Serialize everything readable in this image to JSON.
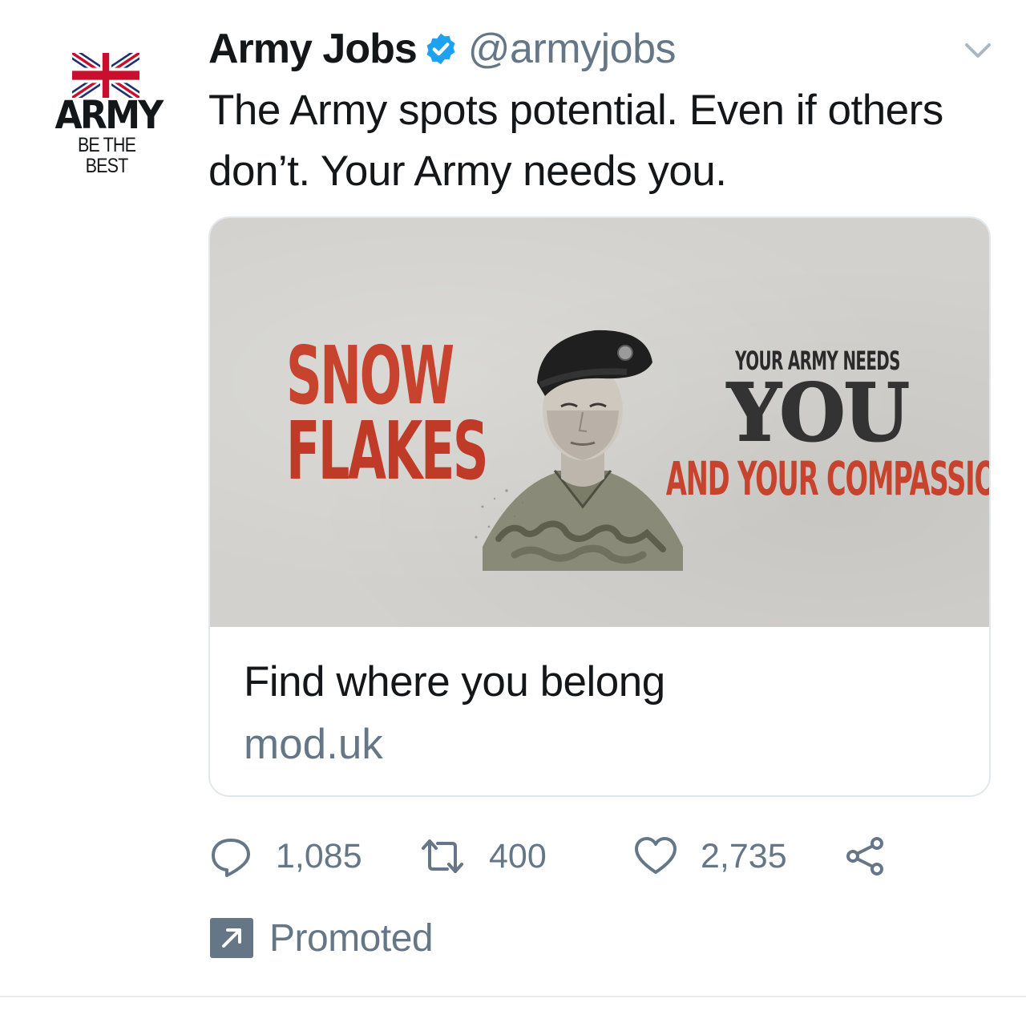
{
  "tweet": {
    "author": {
      "name": "Army Jobs",
      "handle": "@armyjobs",
      "verified": true,
      "verified_icon": "verified-badge-icon",
      "avatar": {
        "wordmark": "ARMY",
        "tagline": "BE THE BEST",
        "flag_icon": "union-jack-icon"
      }
    },
    "menu_icon": "chevron-down-icon",
    "text": "The Army spots potential. Even if others don’t. Your Army needs you.",
    "card": {
      "image": {
        "left_headline": [
          "SNOW",
          "FLAKES"
        ],
        "right_small": "YOUR ARMY NEEDS",
        "right_big": "YOU",
        "right_red": "AND YOUR COMPASSION",
        "figure": "soldier-in-beret-illustration"
      },
      "title": "Find where you belong",
      "domain": "mod.uk"
    },
    "actions": {
      "reply": {
        "icon": "reply-icon",
        "count": "1,085"
      },
      "retweet": {
        "icon": "retweet-icon",
        "count": "400"
      },
      "like": {
        "icon": "heart-icon",
        "count": "2,735"
      },
      "share": {
        "icon": "share-icon"
      }
    },
    "promoted": {
      "icon": "promoted-arrow-icon",
      "label": "Promoted"
    }
  },
  "colors": {
    "text_primary": "#14171a",
    "text_secondary": "#657786",
    "verified_blue": "#1da1f2",
    "card_border": "#e1e8ed",
    "poster_red": "#c7432e",
    "poster_background": "#d2d1cd"
  }
}
